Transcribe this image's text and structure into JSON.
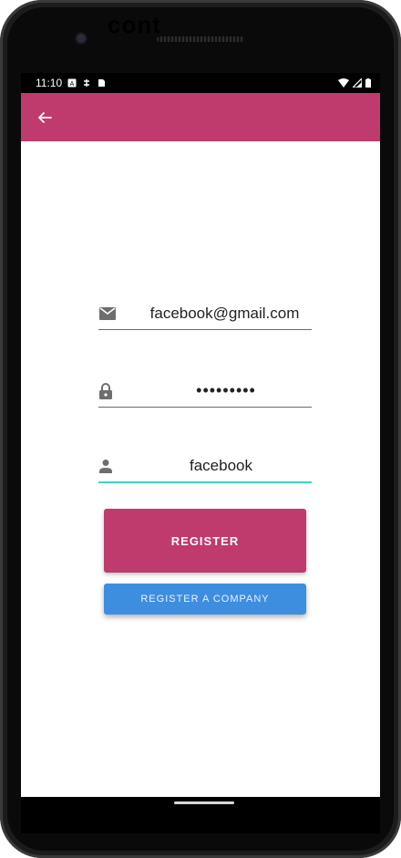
{
  "device": {
    "logo_text": "cont"
  },
  "status_bar": {
    "time": "11:10"
  },
  "app_bar": {
    "back_label": "←"
  },
  "form": {
    "email": {
      "value": "facebook@gmail.com"
    },
    "password": {
      "value": "•••••••••"
    },
    "username": {
      "value": "facebook"
    }
  },
  "buttons": {
    "register": "REGISTER",
    "register_company": "REGISTER A COMPANY"
  },
  "colors": {
    "primary": "#bf3a6d",
    "secondary_button": "#3e8ee0",
    "focus_underline": "#3ed6c3"
  }
}
